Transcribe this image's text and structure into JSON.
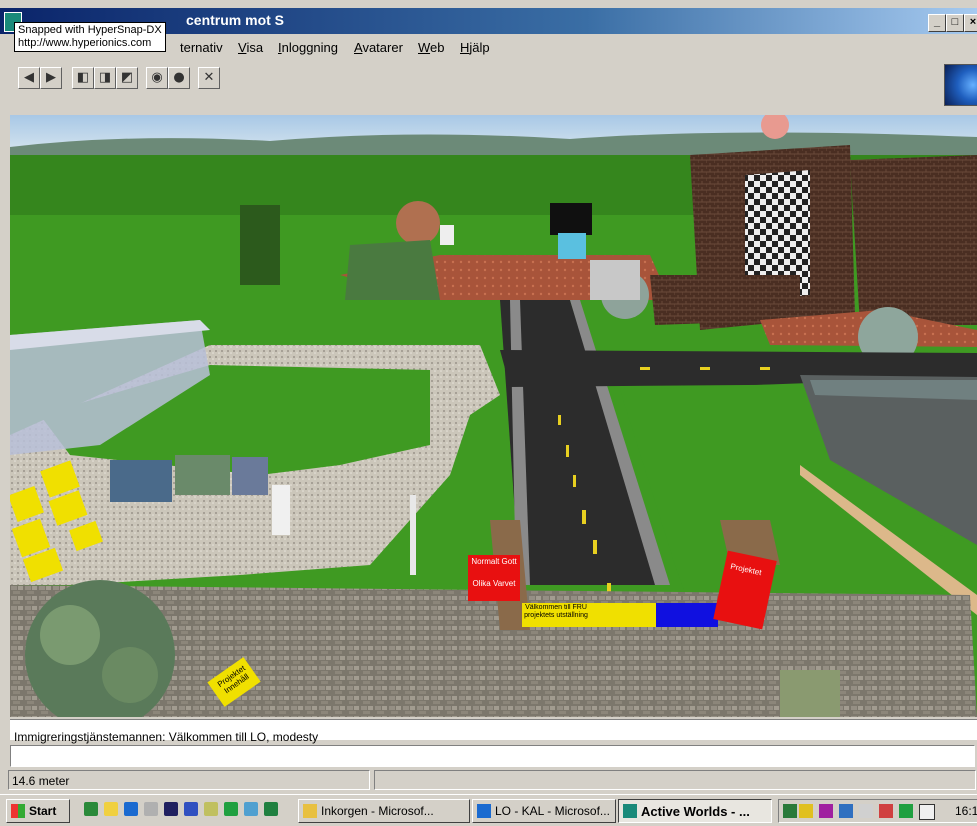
{
  "window": {
    "title": "Active Worlds - LO - KAL - Kunskap centrum mot S",
    "visible_title_fragment": "centrum mot S",
    "controls": {
      "minimize": "_",
      "maximize": "□",
      "close": "×"
    }
  },
  "snap_tooltip": {
    "line1": "Snapped with HyperSnap-DX",
    "line2": "http://www.hyperionics.com"
  },
  "menu": [
    {
      "label": "ternativ",
      "underline": ""
    },
    {
      "label": "Visa",
      "underline": "V"
    },
    {
      "label": "Inloggning",
      "underline": "I"
    },
    {
      "label": "Avatarer",
      "underline": "A"
    },
    {
      "label": "Web",
      "underline": "W"
    },
    {
      "label": "Hjälp",
      "underline": "H"
    }
  ],
  "toolbar": {
    "buttons": [
      "back-icon",
      "forward-icon",
      "view-1-icon",
      "view-2-icon",
      "view-3-icon",
      "camera-icon",
      "record-icon",
      "tools-icon"
    ]
  },
  "scene": {
    "signs": {
      "welcome": "Välkommen till FRU projektets utställning",
      "left_a": "Normalt Gott",
      "left_b": "Olika Varvet",
      "right_a": "Projektet",
      "bottom_left": "Projektet Innehåll"
    },
    "colors": {
      "sky": "#a8c8e0",
      "grass": "#3f9a22",
      "road": "#303030",
      "cobble": "#8a8478"
    }
  },
  "chat": {
    "message": "Immigreringstjänstemannen: Välkommen till LO, modesty",
    "input_value": ""
  },
  "status": {
    "distance": "14.6 meter"
  },
  "taskbar": {
    "start": "Start",
    "tasks": [
      {
        "label": "Inkorgen - Microsof...",
        "active": false
      },
      {
        "label": "LO - KAL - Microsof...",
        "active": false
      },
      {
        "label": "Active Worlds - ...",
        "active": true
      }
    ],
    "clock": "16:1"
  }
}
